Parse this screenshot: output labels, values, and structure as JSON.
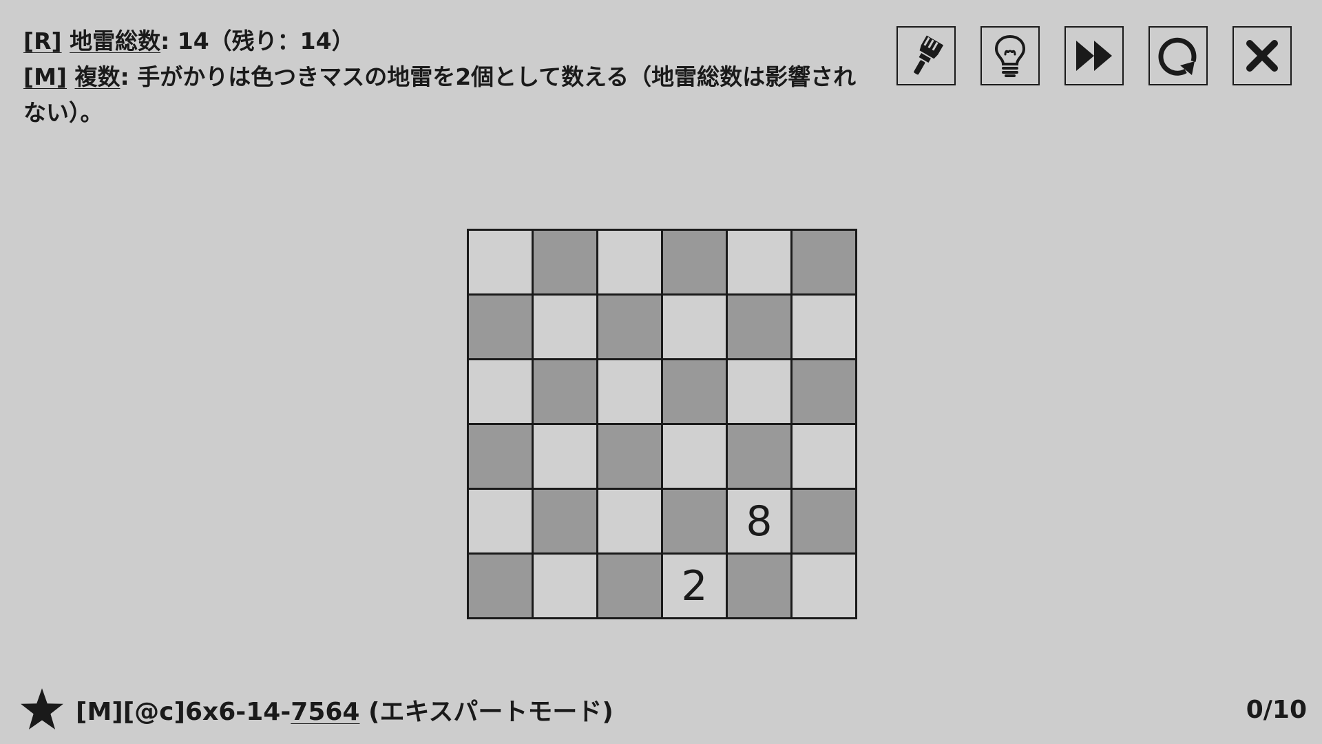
{
  "rules": {
    "line1_prefix": "[R]",
    "line1_term": "地雷総数",
    "line1_rest": ": 14（残り：14）",
    "line2_prefix": "[M]",
    "line2_term": "複数",
    "line2_rest": ": 手がかりは色つきマスの地雷を2個として数える（地雷総数は影響されない）。"
  },
  "toolbar": {
    "buttons": [
      {
        "name": "brush-button",
        "icon": "brush-icon"
      },
      {
        "name": "hint-button",
        "icon": "lightbulb-icon"
      },
      {
        "name": "skip-button",
        "icon": "fast-forward-icon"
      },
      {
        "name": "reset-button",
        "icon": "refresh-icon"
      },
      {
        "name": "close-button",
        "icon": "close-icon"
      }
    ]
  },
  "board": {
    "rows": 6,
    "cols": 6,
    "cells": [
      [
        "",
        "",
        "",
        "",
        "",
        ""
      ],
      [
        "",
        "",
        "",
        "",
        "",
        ""
      ],
      [
        "",
        "",
        "",
        "",
        "",
        ""
      ],
      [
        "",
        "",
        "",
        "",
        "",
        ""
      ],
      [
        "",
        "",
        "",
        "",
        "8",
        ""
      ],
      [
        "",
        "",
        "",
        "2",
        "",
        ""
      ]
    ],
    "shading": [
      [
        "light",
        "dark",
        "light",
        "dark",
        "light",
        "dark"
      ],
      [
        "dark",
        "light",
        "dark",
        "light",
        "dark",
        "light"
      ],
      [
        "light",
        "dark",
        "light",
        "dark",
        "light",
        "dark"
      ],
      [
        "dark",
        "light",
        "dark",
        "light",
        "dark",
        "light"
      ],
      [
        "light",
        "dark",
        "light",
        "dark",
        "light",
        "dark"
      ],
      [
        "dark",
        "light",
        "dark",
        "light",
        "dark",
        "light"
      ]
    ]
  },
  "footer": {
    "icon": "star-icon",
    "puzzle_prefix": "[M][@c]6x6-14-",
    "puzzle_number": "7564",
    "puzzle_mode": " (エキスパートモード)",
    "progress": "0/10"
  }
}
